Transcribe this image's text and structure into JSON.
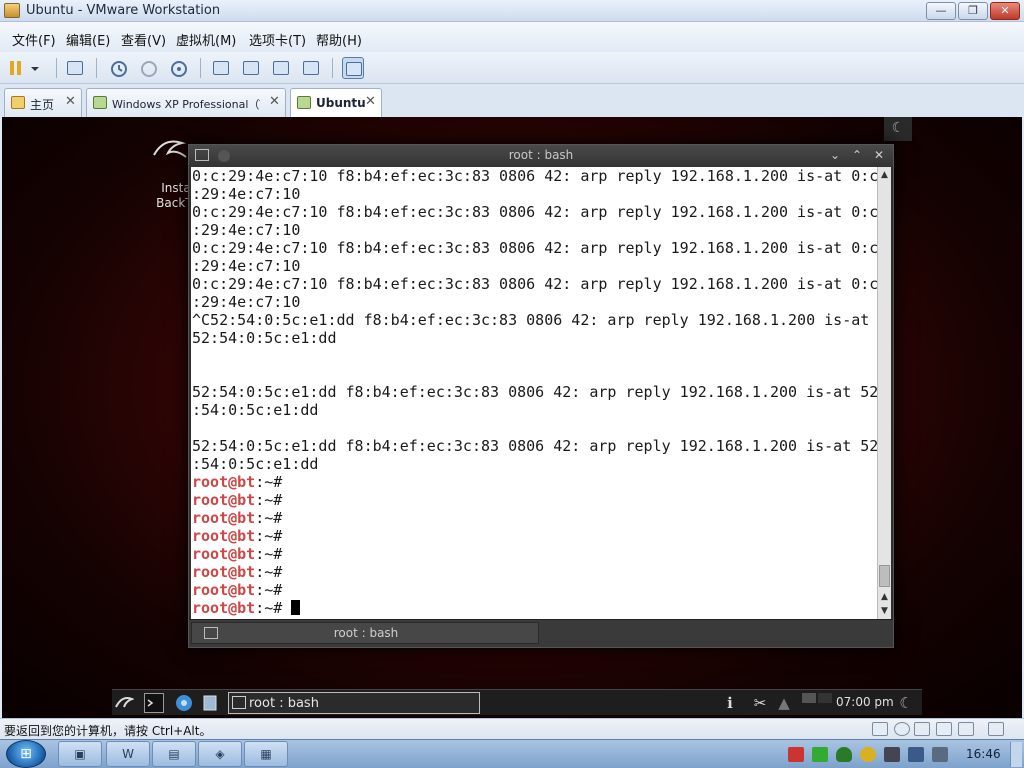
{
  "window": {
    "title": "Ubuntu - VMware Workstation",
    "controls": {
      "minimize": "—",
      "restore": "❐",
      "close": "✕"
    }
  },
  "menubar": {
    "items": [
      "文件(F)",
      "编辑(E)",
      "查看(V)",
      "虚拟机(M)",
      "选项卡(T)",
      "帮助(H)"
    ]
  },
  "tabs": [
    {
      "label": "主页",
      "close": "✕"
    },
    {
      "label": "Windows XP Professional（Te…",
      "close": "✕"
    },
    {
      "label": "Ubuntu",
      "close": "✕",
      "active": true
    }
  ],
  "desktop": {
    "icon_text_1": "Insta",
    "icon_text_2": "BackTr"
  },
  "terminal": {
    "title": "root : bash",
    "tab_label": "root : bash",
    "lines": [
      "0:c:29:4e:c7:10 f8:b4:ef:ec:3c:83 0806 42: arp reply 192.168.1.200 is-at 0:c",
      ":29:4e:c7:10",
      "0:c:29:4e:c7:10 f8:b4:ef:ec:3c:83 0806 42: arp reply 192.168.1.200 is-at 0:c",
      ":29:4e:c7:10",
      "0:c:29:4e:c7:10 f8:b4:ef:ec:3c:83 0806 42: arp reply 192.168.1.200 is-at 0:c",
      ":29:4e:c7:10",
      "0:c:29:4e:c7:10 f8:b4:ef:ec:3c:83 0806 42: arp reply 192.168.1.200 is-at 0:c",
      ":29:4e:c7:10",
      "^C52:54:0:5c:e1:dd f8:b4:ef:ec:3c:83 0806 42: arp reply 192.168.1.200 is-at",
      "52:54:0:5c:e1:dd",
      "",
      "",
      "52:54:0:5c:e1:dd f8:b4:ef:ec:3c:83 0806 42: arp reply 192.168.1.200 is-at 52",
      ":54:0:5c:e1:dd",
      "",
      "52:54:0:5c:e1:dd f8:b4:ef:ec:3c:83 0806 42: arp reply 192.168.1.200 is-at 52",
      ":54:0:5c:e1:dd"
    ],
    "prompt_user": "root@bt",
    "prompt_suffix": ":~#",
    "prompt_count": 8
  },
  "guest_panel": {
    "task_label": "root : bash",
    "clock": "07:00 pm"
  },
  "statusbar": {
    "hint": "要返回到您的计算机，请按 Ctrl+Alt。"
  },
  "taskbar": {
    "clock": "16:46"
  },
  "colors": {
    "prompt": "#d04545",
    "terminal_bg": "#ffffff",
    "desktop_red": "#6a0e0e"
  }
}
